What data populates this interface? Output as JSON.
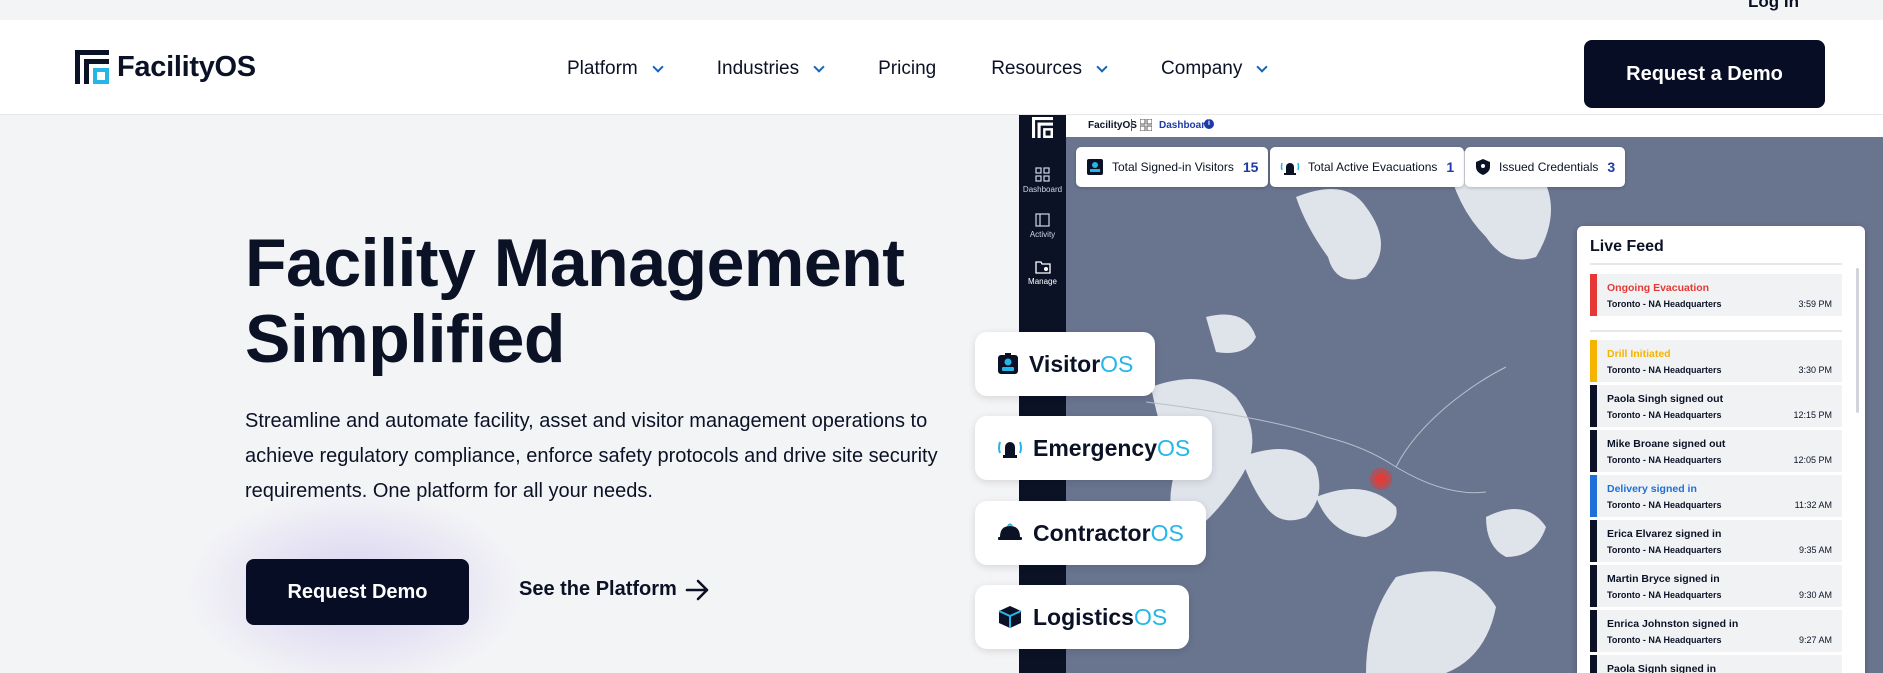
{
  "utility": {
    "login": "Log In"
  },
  "header": {
    "logo_text": "FacilityOS",
    "nav": [
      {
        "label": "Platform",
        "dropdown": true
      },
      {
        "label": "Industries",
        "dropdown": true
      },
      {
        "label": "Pricing",
        "dropdown": false
      },
      {
        "label": "Resources",
        "dropdown": true
      },
      {
        "label": "Company",
        "dropdown": true
      }
    ],
    "cta": "Request a Demo"
  },
  "hero": {
    "title_line1": "Facility Management",
    "title_line2": "Simplified",
    "description": "Streamline and automate facility, asset and visitor management operations to achieve regulatory compliance, enforce safety protocols and drive site security requirements. One platform for all your needs.",
    "primary_cta": "Request Demo",
    "secondary_cta": "See the Platform"
  },
  "dashboard": {
    "brand": "FacilityOS",
    "breadcrumb": "Dashboard",
    "info_glyph": "i",
    "sidebar": [
      {
        "label": "Dashboard",
        "icon": "grid-icon"
      },
      {
        "label": "Activity",
        "icon": "activity-icon"
      },
      {
        "label": "Manage",
        "icon": "manage-icon"
      }
    ],
    "stats": [
      {
        "label": "Total Signed-in Visitors",
        "value": "15"
      },
      {
        "label": "Total Active Evacuations",
        "value": "1"
      },
      {
        "label": "Issued Credentials",
        "value": "3"
      }
    ],
    "live_feed": {
      "title": "Live Feed",
      "items": [
        {
          "title": "Ongoing Evacuation",
          "location": "Toronto - NA Headquarters",
          "time": "3:59 PM",
          "color": "#e53935"
        },
        {
          "title": "Drill Initiated",
          "location": "Toronto - NA Headquarters",
          "time": "3:30 PM",
          "color": "#f5b400"
        },
        {
          "title": "Paola Singh signed out",
          "location": "Toronto - NA Headquarters",
          "time": "12:15 PM",
          "color": "#0b1226"
        },
        {
          "title": "Mike Broane signed out",
          "location": "Toronto - NA Headquarters",
          "time": "12:05 PM",
          "color": "#0b1226"
        },
        {
          "title": "Delivery signed in",
          "location": "Toronto - NA Headquarters",
          "time": "11:32 AM",
          "color": "#1e6fd9"
        },
        {
          "title": "Erica Elvarez signed in",
          "location": "Toronto - NA Headquarters",
          "time": "9:35 AM",
          "color": "#0b1226"
        },
        {
          "title": "Martin Bryce signed in",
          "location": "Toronto - NA Headquarters",
          "time": "9:30 AM",
          "color": "#0b1226"
        },
        {
          "title": "Enrica Johnston signed in",
          "location": "Toronto - NA Headquarters",
          "time": "9:27 AM",
          "color": "#0b1226"
        },
        {
          "title": "Paola Signh signed in",
          "location": "",
          "time": "",
          "color": "#0b1226"
        }
      ]
    }
  },
  "products": [
    {
      "name": "Visitor",
      "suffix": "OS",
      "icon": "badge-icon"
    },
    {
      "name": "Emergency",
      "suffix": "OS",
      "icon": "alarm-icon"
    },
    {
      "name": "Contractor",
      "suffix": "OS",
      "icon": "hardhat-icon"
    },
    {
      "name": "Logistics",
      "suffix": "OS",
      "icon": "package-icon"
    }
  ],
  "colors": {
    "navy": "#060d24",
    "accent_blue": "#1565c0",
    "os_cyan": "#25b6e8",
    "map": "#69748f",
    "land": "#dfe3ea"
  }
}
